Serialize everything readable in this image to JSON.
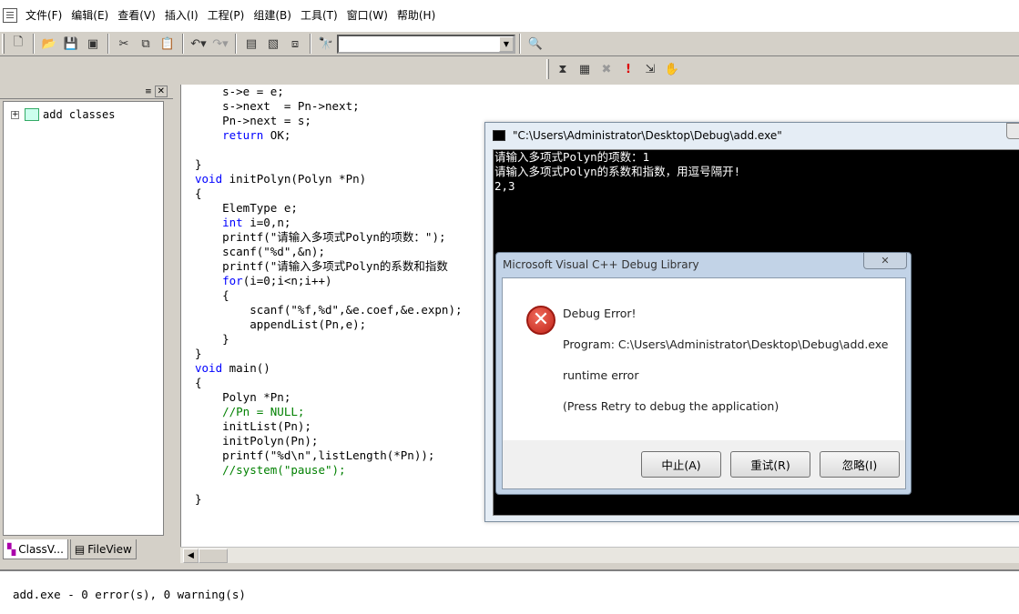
{
  "menubar": {
    "items": [
      "文件(F)",
      "编辑(E)",
      "查看(V)",
      "插入(I)",
      "工程(P)",
      "组建(B)",
      "工具(T)",
      "窗口(W)",
      "帮助(H)"
    ]
  },
  "toolbar": {
    "combo_value": ""
  },
  "workspace": {
    "tree_root": "add classes",
    "tabs": [
      "ClassV...",
      "FileView"
    ]
  },
  "editor": {
    "lines": [
      "    s->e = e;",
      "    s->next  = Pn->next;",
      "    Pn->next = s;",
      "    return OK;",
      "",
      "}",
      "void initPolyn(Polyn *Pn)",
      "{",
      "    ElemType e;",
      "    int i=0,n;",
      "    printf(\"请输入多项式Polyn的项数：\");",
      "    scanf(\"%d\",&n);",
      "    printf(\"请输入多项式Polyn的系数和指数",
      "    for(i=0;i<n;i++)",
      "    {",
      "        scanf(\"%f,%d\",&e.coef,&e.expn);",
      "        appendList(Pn,e);",
      "    }",
      "}",
      "void main()",
      "{",
      "    Polyn *Pn;",
      "    //Pn = NULL;",
      "    initList(Pn);",
      "    initPolyn(Pn);",
      "    printf(\"%d\\n\",listLength(*Pn));",
      "    //system(\"pause\");",
      "",
      "}"
    ]
  },
  "output": {
    "text": "add.exe - 0 error(s), 0 warning(s)"
  },
  "console": {
    "title": "\"C:\\Users\\Administrator\\Desktop\\Debug\\add.exe\"",
    "lines": [
      "请输入多项式Polyn的项数：1",
      "请输入多项式Polyn的系数和指数，用逗号隔开!",
      "2,3"
    ]
  },
  "dialog": {
    "title": "Microsoft Visual C++ Debug Library",
    "heading": "Debug Error!",
    "program": "Program: C:\\Users\\Administrator\\Desktop\\Debug\\add.exe",
    "error": "runtime error",
    "hint": "(Press Retry to debug the application)",
    "buttons": {
      "abort": "中止(A)",
      "retry": "重试(R)",
      "ignore": "忽略(I)"
    }
  }
}
